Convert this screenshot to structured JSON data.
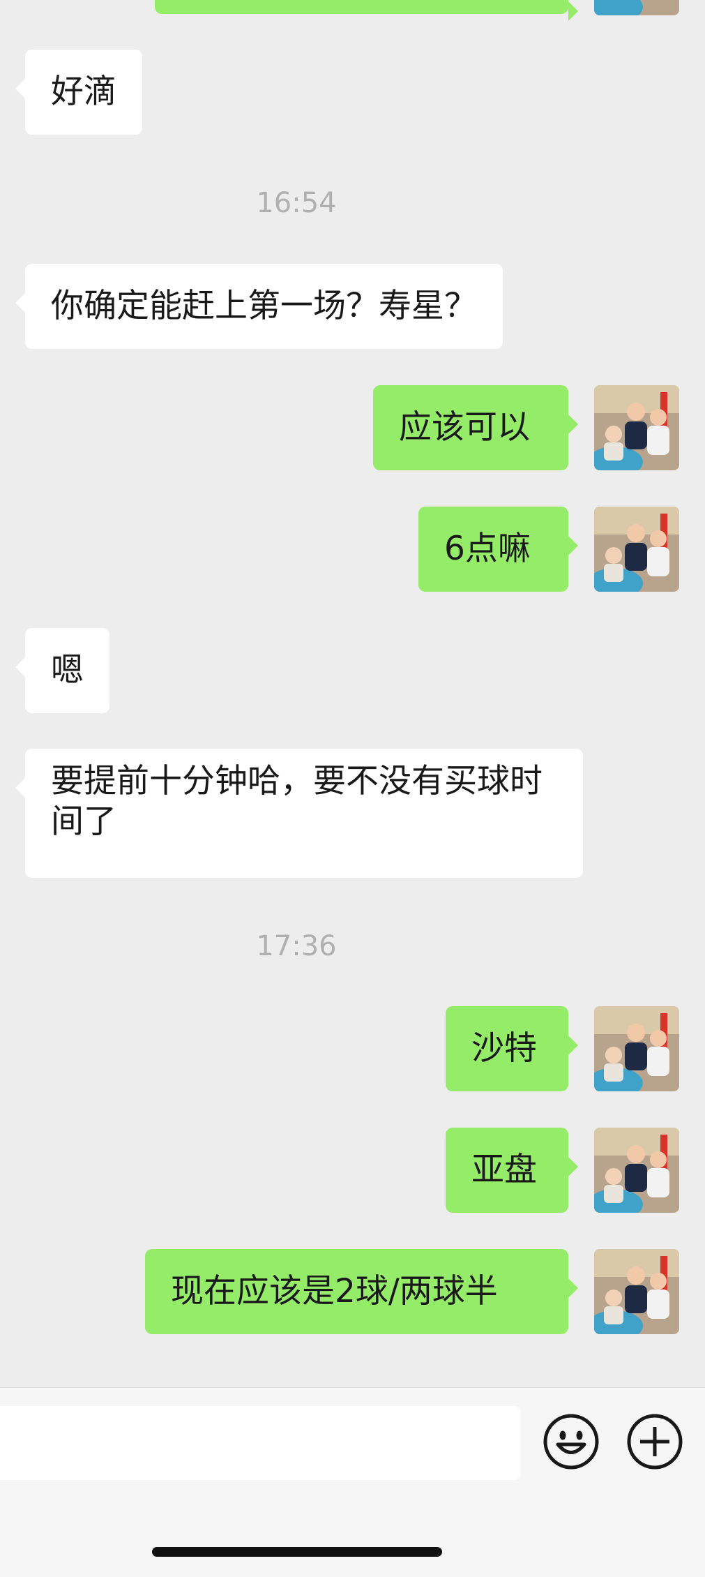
{
  "messages": [
    {
      "text": "好滴"
    },
    {
      "time": "16:54"
    },
    {
      "text": "你确定能赶上第一场？寿星？"
    },
    {
      "text": "应该可以"
    },
    {
      "text": "6点嘛"
    },
    {
      "text": "嗯"
    },
    {
      "text": "要提前十分钟哈，要不没有买球时间了"
    },
    {
      "time": "17:36"
    },
    {
      "text": "沙特"
    },
    {
      "text": "亚盘"
    },
    {
      "text": "现在应该是2球/两球半"
    }
  ],
  "input_bar": {
    "placeholder": ""
  },
  "icons": {
    "emoji": "emoji-face-icon",
    "more": "plus-circle-icon"
  },
  "colors": {
    "outgoing_bubble": "#95ec69",
    "incoming_bubble": "#ffffff",
    "background": "#ededed",
    "timestamp": "#b0b0b0"
  }
}
